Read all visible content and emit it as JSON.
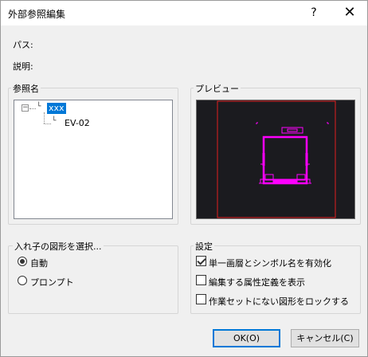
{
  "window": {
    "title": "外部参照編集",
    "help_label": "?",
    "close_label": "✕"
  },
  "fields": {
    "path_label": "パス:",
    "description_label": "説明:"
  },
  "reference": {
    "group_title": "参照名",
    "tree": {
      "root": "xxx",
      "child": "EV-02"
    }
  },
  "preview": {
    "group_title": "プレビュー",
    "colors": {
      "background": "#1b1b1f",
      "frame": "#e01f1f",
      "drawing": "#ff00ff"
    }
  },
  "nested": {
    "group_title": "入れ子の図形を選択...",
    "options": [
      "自動",
      "プロンプト"
    ],
    "selected": "自動"
  },
  "settings": {
    "group_title": "設定",
    "checkboxes": [
      {
        "label": "単一画層とシンボル名を有効化",
        "checked": true
      },
      {
        "label": "編集する属性定義を表示",
        "checked": false
      },
      {
        "label": "作業セットにない図形をロックする",
        "checked": false
      }
    ]
  },
  "buttons": {
    "ok": "OK(O)",
    "cancel": "キャンセル(C)"
  }
}
